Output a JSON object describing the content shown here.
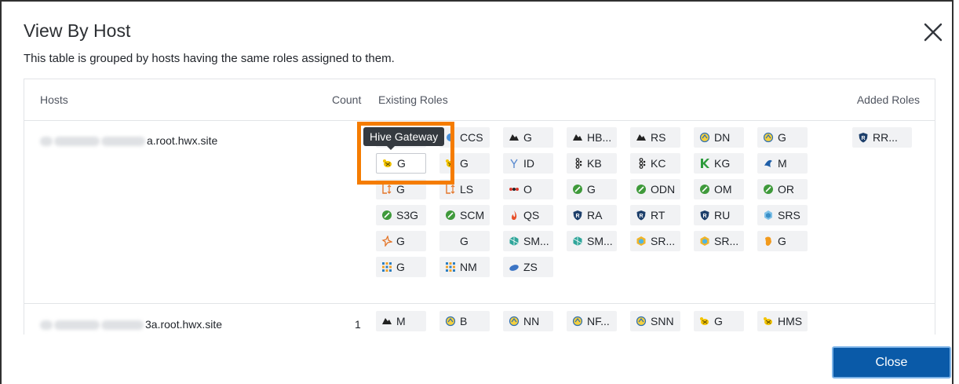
{
  "dialog": {
    "title": "View By Host",
    "subtitle": "This table is grouped by hosts having the same roles assigned to them.",
    "close_button_label": "Close"
  },
  "table": {
    "headers": {
      "hosts": "Hosts",
      "count": "Count",
      "existing_roles": "Existing Roles",
      "added_roles": "Added Roles"
    },
    "rows": [
      {
        "host": "a.root.hwx.site",
        "count": "",
        "existing_roles": [
          {
            "label": "",
            "icon": "hive-bee-icon"
          },
          {
            "label": "CCS",
            "icon": "cruise-control-icon"
          },
          {
            "label": "G",
            "icon": "hbase-whale-icon"
          },
          {
            "label": "HB...",
            "icon": "hbase-whale-icon"
          },
          {
            "label": "RS",
            "icon": "hbase-whale-icon"
          },
          {
            "label": "DN",
            "icon": "hdfs-icon"
          },
          {
            "label": "G",
            "icon": "hdfs-icon"
          },
          {
            "label": "G",
            "icon": "hive-bee-icon"
          },
          {
            "label": "G",
            "icon": "hive-bee-icon"
          },
          {
            "label": "ID",
            "icon": "hue-icon"
          },
          {
            "label": "KB",
            "icon": "kafka-icon"
          },
          {
            "label": "KC",
            "icon": "kafka-icon"
          },
          {
            "label": "KG",
            "icon": "kudu-icon"
          },
          {
            "label": "M",
            "icon": "livy-icon"
          },
          {
            "label": "G",
            "icon": "livy-arrows-icon"
          },
          {
            "label": "LS",
            "icon": "livy-arrows-icon"
          },
          {
            "label": "O",
            "icon": "oozie-icon"
          },
          {
            "label": "G",
            "icon": "ozone-icon"
          },
          {
            "label": "ODN",
            "icon": "ozone-icon"
          },
          {
            "label": "OM",
            "icon": "ozone-icon"
          },
          {
            "label": "OR",
            "icon": "ozone-icon"
          },
          {
            "label": "S3G",
            "icon": "ozone-icon"
          },
          {
            "label": "SCM",
            "icon": "ozone-icon"
          },
          {
            "label": "QS",
            "icon": "queue-flame-icon"
          },
          {
            "label": "RA",
            "icon": "ranger-shield-icon"
          },
          {
            "label": "RT",
            "icon": "ranger-shield-icon"
          },
          {
            "label": "RU",
            "icon": "ranger-shield-icon"
          },
          {
            "label": "SRS",
            "icon": "schema-registry-icon"
          },
          {
            "label": "G",
            "icon": "spark-star-icon"
          },
          {
            "label": "G",
            "icon": ""
          },
          {
            "label": "SM...",
            "icon": "streams-messaging-icon"
          },
          {
            "label": "SM...",
            "icon": "streams-messaging-icon"
          },
          {
            "label": "SR...",
            "icon": "streams-replication-icon"
          },
          {
            "label": "SR...",
            "icon": "streams-replication-icon"
          },
          {
            "label": "G",
            "icon": "tez-icon"
          },
          {
            "label": "G",
            "icon": "yarn-grid-icon"
          },
          {
            "label": "NM",
            "icon": "yarn-grid-icon"
          },
          {
            "label": "ZS",
            "icon": "zookeeper-icon"
          }
        ],
        "added_roles": [
          {
            "label": "RR...",
            "icon": "ranger-shield-icon"
          }
        ]
      },
      {
        "host": "3a.root.hwx.site",
        "count": "1",
        "existing_roles": [
          {
            "label": "M",
            "icon": "hbase-whale-icon"
          },
          {
            "label": "B",
            "icon": "hdfs-icon"
          },
          {
            "label": "NN",
            "icon": "hdfs-icon"
          },
          {
            "label": "NF...",
            "icon": "hdfs-icon"
          },
          {
            "label": "SNN",
            "icon": "hdfs-icon"
          },
          {
            "label": "G",
            "icon": "hive-bee-icon"
          },
          {
            "label": "HMS",
            "icon": "hive-bee-icon"
          }
        ],
        "added_roles": []
      }
    ]
  },
  "tooltip": {
    "text": "Hive Gateway"
  },
  "colors": {
    "accent": "#0a5aa8",
    "highlight": "#f57c00",
    "tooltip_bg": "#353a40",
    "chip_bg": "#f1f2f4"
  }
}
